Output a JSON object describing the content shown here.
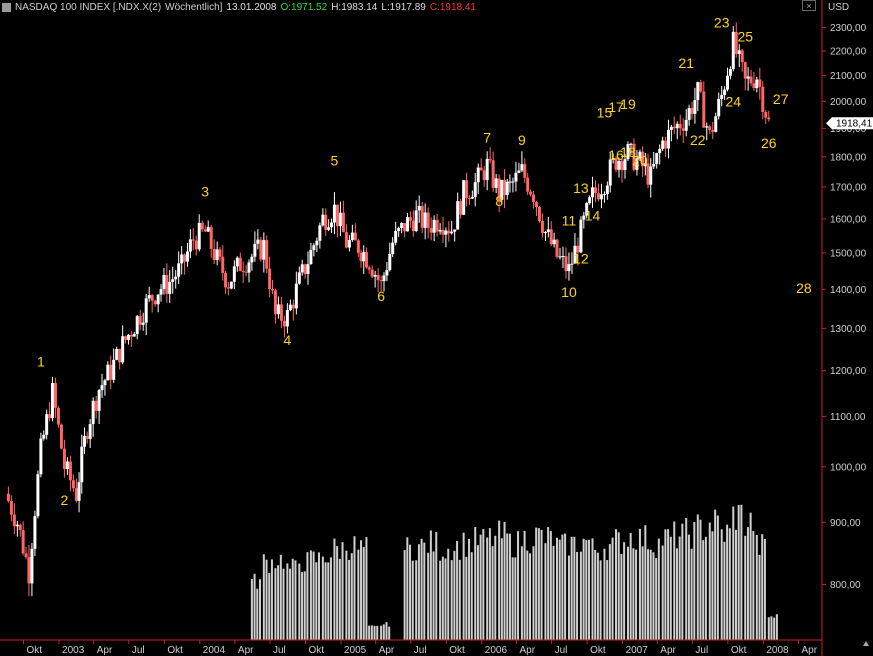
{
  "header": {
    "instrument": "NASDAQ 100 INDEX [.NDX.X(2)",
    "period": "Wöchentlich]",
    "date": "13.01.2008",
    "open": "O:1971.52",
    "high": "H:1983.14",
    "low": "L:1917.89",
    "close": "C:1918.41",
    "close_button": "×"
  },
  "colors": {
    "background": "#000000",
    "axis": "#cc2222",
    "label": "#ffd21f",
    "open_value": "#33dd33",
    "close_value": "#ff3333",
    "candle": "#ffffff",
    "candle_down": "#ff6666",
    "volume": "#cfcfcf"
  },
  "chart_data": {
    "type": "line",
    "title": "NASDAQ 100 INDEX [.NDX.X(2) Wöchentlich]",
    "currency_label": "USD",
    "y_scale": "log",
    "ylim": [
      720,
      2360
    ],
    "y_ticks": [
      "800,00",
      "900,00",
      "1000,00",
      "1100,00",
      "1200,00",
      "1300,00",
      "1400,00",
      "1500,00",
      "1600,00",
      "1700,00",
      "1800,00",
      "1900,00",
      "2000,00",
      "2100,00",
      "2200,00",
      "2300,00"
    ],
    "x_ticks": [
      "Okt",
      "2003",
      "Apr",
      "Jul",
      "Okt",
      "2004",
      "Apr",
      "Jul",
      "Okt",
      "2005",
      "Apr",
      "Jul",
      "Okt",
      "2006",
      "Apr",
      "Jul",
      "Okt",
      "2007",
      "Apr",
      "Jul",
      "Okt",
      "2008",
      "Apr"
    ],
    "last_price_label": "1918,41",
    "series": [
      {
        "name": "NASDAQ 100",
        "x": [
          "2002-08",
          "2002-09",
          "2002-10",
          "2002-11",
          "2002-12",
          "2003-01",
          "2003-02",
          "2003-03",
          "2003-04",
          "2003-05",
          "2003-06",
          "2003-07",
          "2003-08",
          "2003-09",
          "2003-10",
          "2003-11",
          "2003-12",
          "2004-01",
          "2004-02",
          "2004-03",
          "2004-04",
          "2004-05",
          "2004-06",
          "2004-07",
          "2004-08",
          "2004-09",
          "2004-10",
          "2004-11",
          "2004-12",
          "2005-01",
          "2005-02",
          "2005-03",
          "2005-04",
          "2005-05",
          "2005-06",
          "2005-07",
          "2005-08",
          "2005-09",
          "2005-10",
          "2005-11",
          "2005-12",
          "2006-01",
          "2006-02",
          "2006-03",
          "2006-04",
          "2006-05",
          "2006-06",
          "2006-07",
          "2006-08",
          "2006-09",
          "2006-10",
          "2006-11",
          "2006-12",
          "2007-01",
          "2007-02",
          "2007-03",
          "2007-04",
          "2007-05",
          "2007-06",
          "2007-07",
          "2007-08",
          "2007-09",
          "2007-10",
          "2007-11",
          "2007-12",
          "2008-01"
        ],
        "values": [
          950,
          900,
          820,
          1030,
          1150,
          1000,
          950,
          1080,
          1160,
          1200,
          1260,
          1310,
          1360,
          1400,
          1420,
          1460,
          1540,
          1560,
          1480,
          1420,
          1470,
          1490,
          1520,
          1330,
          1330,
          1420,
          1500,
          1600,
          1630,
          1530,
          1520,
          1480,
          1410,
          1530,
          1580,
          1610,
          1580,
          1600,
          1570,
          1680,
          1710,
          1770,
          1680,
          1700,
          1750,
          1680,
          1560,
          1490,
          1450,
          1560,
          1670,
          1720,
          1790,
          1810,
          1780,
          1730,
          1850,
          1900,
          1940,
          2030,
          1870,
          2020,
          2230,
          2070,
          2100,
          1918
        ]
      }
    ],
    "volume_series": [
      {
        "name": "Volume",
        "x": [
          "2002-08",
          "2002-09",
          "2002-10",
          "2002-11",
          "2002-12",
          "2003-01",
          "2003-02",
          "2003-03",
          "2003-04",
          "2003-05",
          "2003-06",
          "2003-07",
          "2003-08",
          "2003-09",
          "2003-10",
          "2003-11",
          "2003-12",
          "2004-01",
          "2004-02",
          "2004-03",
          "2004-04",
          "2004-05",
          "2004-06",
          "2004-07",
          "2004-08",
          "2004-09",
          "2004-10",
          "2004-11",
          "2004-12",
          "2005-01",
          "2005-02",
          "2005-03",
          "2005-04",
          "2005-05",
          "2005-06",
          "2005-07",
          "2005-08",
          "2005-09",
          "2005-10",
          "2005-11",
          "2005-12",
          "2006-01",
          "2006-02",
          "2006-03",
          "2006-04",
          "2006-05",
          "2006-06",
          "2006-07",
          "2006-08",
          "2006-09",
          "2006-10",
          "2006-11",
          "2006-12",
          "2007-01",
          "2007-02",
          "2007-03",
          "2007-04",
          "2007-05",
          "2007-06",
          "2007-07",
          "2007-08",
          "2007-09",
          "2007-10",
          "2007-11",
          "2007-12",
          "2008-01"
        ],
        "values": [
          0,
          0,
          0,
          0,
          0,
          0,
          0,
          0,
          0,
          0,
          0,
          0,
          0,
          0,
          0,
          0,
          0,
          0,
          0,
          0,
          0,
          0.45,
          0.6,
          0.62,
          0.55,
          0.6,
          0.62,
          0.65,
          0.7,
          0.72,
          0.7,
          0.1,
          0.12,
          0,
          0.7,
          0.72,
          0.74,
          0.7,
          0.72,
          0.74,
          0.76,
          0.78,
          0.8,
          0.74,
          0.78,
          0.8,
          0.78,
          0.72,
          0.74,
          0.76,
          0.7,
          0.72,
          0.76,
          0.8,
          0.78,
          0.74,
          0.78,
          0.8,
          0.82,
          0.86,
          0.9,
          0.82,
          0.96,
          0.9,
          0.72,
          0.18
        ]
      }
    ],
    "wave_labels": [
      {
        "text": "1",
        "date": "2002-11",
        "value": 1210
      },
      {
        "text": "2",
        "date": "2003-01",
        "value": 930
      },
      {
        "text": "3",
        "date": "2004-01",
        "value": 1670
      },
      {
        "text": "4",
        "date": "2004-08",
        "value": 1260
      },
      {
        "text": "5",
        "date": "2004-12",
        "value": 1770
      },
      {
        "text": "6",
        "date": "2005-04",
        "value": 1370
      },
      {
        "text": "7",
        "date": "2006-01",
        "value": 1850
      },
      {
        "text": "8",
        "date": "2006-02",
        "value": 1640
      },
      {
        "text": "9",
        "date": "2006-04",
        "value": 1840
      },
      {
        "text": "10",
        "date": "2006-08",
        "value": 1380
      },
      {
        "text": "11",
        "date": "2006-08",
        "value": 1580
      },
      {
        "text": "12",
        "date": "2006-09",
        "value": 1470
      },
      {
        "text": "13",
        "date": "2006-09",
        "value": 1680
      },
      {
        "text": "14",
        "date": "2006-10",
        "value": 1595
      },
      {
        "text": "15",
        "date": "2006-11",
        "value": 1940
      },
      {
        "text": "16",
        "date": "2006-12",
        "value": 1790
      },
      {
        "text": "17",
        "date": "2006-12",
        "value": 1960
      },
      {
        "text": "18",
        "date": "2007-01",
        "value": 1800
      },
      {
        "text": "19",
        "date": "2007-01",
        "value": 1970
      },
      {
        "text": "20",
        "date": "2007-02",
        "value": 1770
      },
      {
        "text": "21",
        "date": "2007-06",
        "value": 2130
      },
      {
        "text": "22",
        "date": "2007-07",
        "value": 1840
      },
      {
        "text": "23",
        "date": "2007-09",
        "value": 2300
      },
      {
        "text": "24",
        "date": "2007-10",
        "value": 1980
      },
      {
        "text": "25",
        "date": "2007-11",
        "value": 2240
      },
      {
        "text": "26",
        "date": "2008-01",
        "value": 1830
      },
      {
        "text": "27",
        "date": "2008-02",
        "value": 1990
      },
      {
        "text": "28",
        "date": "2008-04",
        "value": 1390
      }
    ]
  }
}
